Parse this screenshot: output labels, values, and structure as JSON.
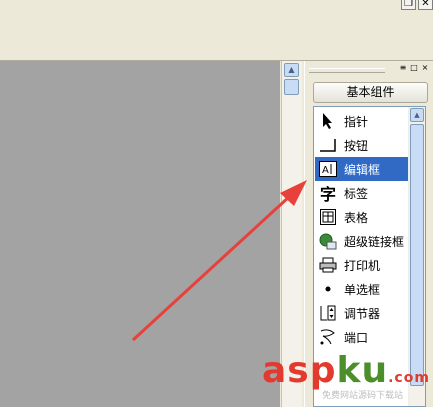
{
  "window": {
    "restore_glyph": "❐",
    "close_glyph": "✕"
  },
  "panel": {
    "tab_label": "基本组件",
    "ctrl_glyphs": [
      "≡",
      "□",
      "×"
    ],
    "items": [
      {
        "label": "指针",
        "icon": "pointer-icon"
      },
      {
        "label": "按钮",
        "icon": "button-icon"
      },
      {
        "label": "编辑框",
        "icon": "editbox-icon",
        "selected": true
      },
      {
        "label": "标签",
        "icon": "label-icon"
      },
      {
        "label": "表格",
        "icon": "table-icon"
      },
      {
        "label": "超级链接框",
        "icon": "hyperlink-icon"
      },
      {
        "label": "打印机",
        "icon": "printer-icon"
      },
      {
        "label": "单选框",
        "icon": "radio-icon"
      },
      {
        "label": "调节器",
        "icon": "spinner-icon"
      },
      {
        "label": "端口",
        "icon": "port-icon"
      }
    ]
  },
  "watermark": {
    "brand_a": "asp",
    "brand_b": "ku",
    "brand_c": ".com",
    "sub": "免费网站源码下载站"
  },
  "colors": {
    "accent": "#316ac5",
    "arrow": "#e8403a"
  }
}
